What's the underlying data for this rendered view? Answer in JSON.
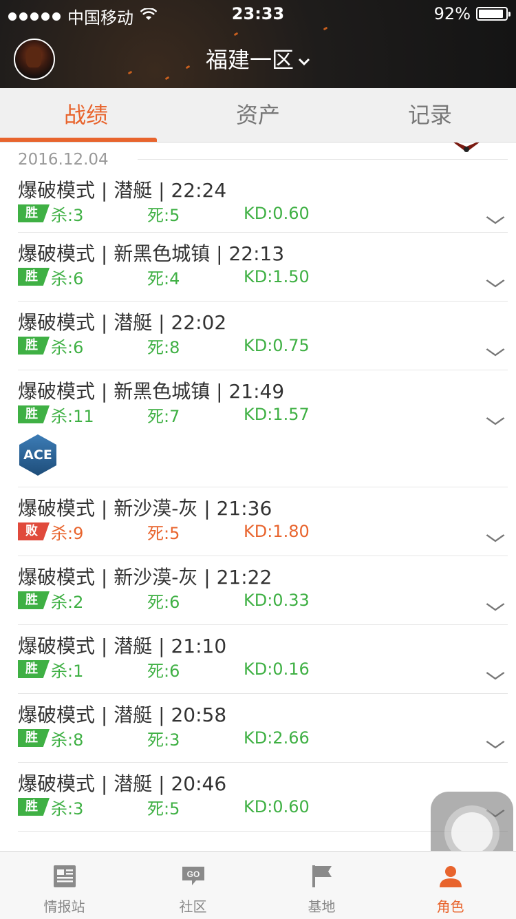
{
  "status_bar": {
    "carrier": "中国移动",
    "time": "23:33",
    "battery": "92%",
    "battery_level": 0.92
  },
  "header": {
    "server": "福建一区"
  },
  "tabs": [
    {
      "label": "战绩",
      "active": true
    },
    {
      "label": "资产",
      "active": false
    },
    {
      "label": "记录",
      "active": false
    }
  ],
  "records": {
    "date": "2016.12.04",
    "items": [
      {
        "title": "爆破模式 | 潜艇 | 22:24",
        "result": "胜",
        "kill": "杀:3",
        "death": "死:5",
        "kd": "KD:0.60"
      },
      {
        "title": "爆破模式 | 新黑色城镇 | 22:13",
        "result": "胜",
        "kill": "杀:6",
        "death": "死:4",
        "kd": "KD:1.50"
      },
      {
        "title": "爆破模式 | 潜艇 | 22:02",
        "result": "胜",
        "kill": "杀:6",
        "death": "死:8",
        "kd": "KD:0.75"
      },
      {
        "title": "爆破模式 | 新黑色城镇 | 21:49",
        "result": "胜",
        "kill": "杀:11",
        "death": "死:7",
        "kd": "KD:1.57",
        "badge": "ACE"
      },
      {
        "title": "爆破模式 | 新沙漠-灰 | 21:36",
        "result": "败",
        "kill": "杀:9",
        "death": "死:5",
        "kd": "KD:1.80"
      },
      {
        "title": "爆破模式 | 新沙漠-灰 | 21:22",
        "result": "胜",
        "kill": "杀:2",
        "death": "死:6",
        "kd": "KD:0.33"
      },
      {
        "title": "爆破模式 | 潜艇 | 21:10",
        "result": "胜",
        "kill": "杀:1",
        "death": "死:6",
        "kd": "KD:0.16"
      },
      {
        "title": "爆破模式 | 潜艇 | 20:58",
        "result": "胜",
        "kill": "杀:8",
        "death": "死:3",
        "kd": "KD:2.66"
      },
      {
        "title": "爆破模式 | 潜艇 | 20:46",
        "result": "胜",
        "kill": "杀:3",
        "death": "死:5",
        "kd": "KD:0.60"
      }
    ]
  },
  "bottom_nav": [
    {
      "label": "情报站",
      "icon": "news-icon"
    },
    {
      "label": "社区",
      "icon": "go-chat-icon"
    },
    {
      "label": "基地",
      "icon": "flag-icon"
    },
    {
      "label": "角色",
      "icon": "person-icon",
      "active": true
    }
  ],
  "colors": {
    "accent": "#e8642d",
    "win": "#3fb044",
    "loss": "#e04a3c"
  }
}
